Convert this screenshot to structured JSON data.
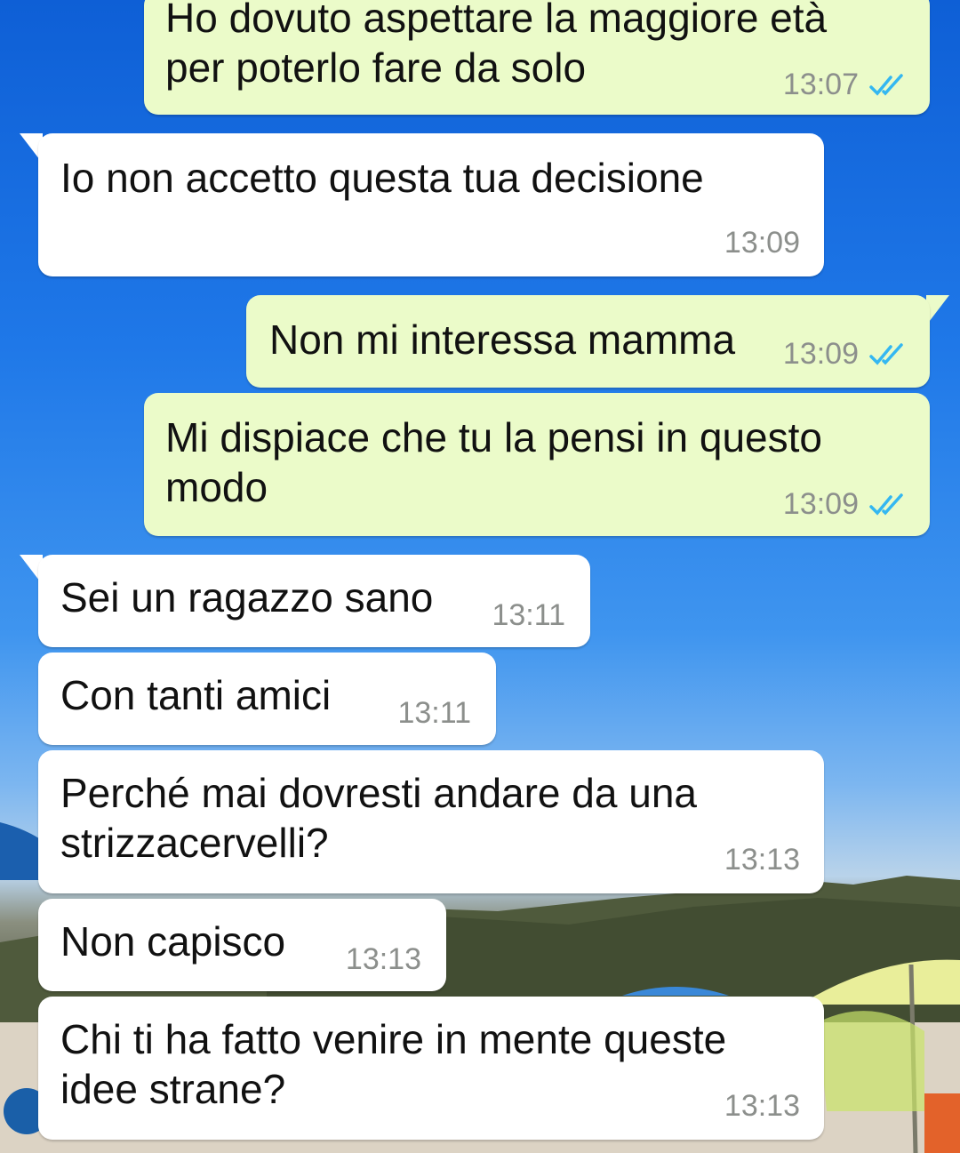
{
  "messages": [
    {
      "id": 1,
      "direction": "outgoing",
      "text": "Ho dovuto aspettare la maggiore età\nper poterlo fare da solo",
      "time": "13:07",
      "status": "read"
    },
    {
      "id": 2,
      "direction": "incoming",
      "text": "Io non accetto questa tua decisione",
      "time": "13:09"
    },
    {
      "id": 3,
      "direction": "outgoing",
      "text": "Non mi interessa mamma",
      "time": "13:09",
      "status": "read"
    },
    {
      "id": 4,
      "direction": "outgoing",
      "text": "Mi dispiace che tu la pensi in questo\nmodo",
      "time": "13:09",
      "status": "read"
    },
    {
      "id": 5,
      "direction": "incoming",
      "text": "Sei un ragazzo sano",
      "time": "13:11"
    },
    {
      "id": 6,
      "direction": "incoming",
      "text": "Con tanti amici",
      "time": "13:11"
    },
    {
      "id": 7,
      "direction": "incoming",
      "text": "Perché mai dovresti andare da una\nstrizzacervelli?",
      "time": "13:13"
    },
    {
      "id": 8,
      "direction": "incoming",
      "text": "Non capisco",
      "time": "13:13"
    },
    {
      "id": 9,
      "direction": "incoming",
      "text": "Chi ti ha fatto venire in mente queste\nidee strane?",
      "time": "13:13"
    }
  ],
  "colors": {
    "incoming_bubble": "#ffffff",
    "outgoing_bubble": "#ebfbc9",
    "read_ticks": "#34b7f1",
    "timestamp": "#8c8f8c"
  },
  "icons": {
    "read_receipt": "double-check-icon"
  }
}
